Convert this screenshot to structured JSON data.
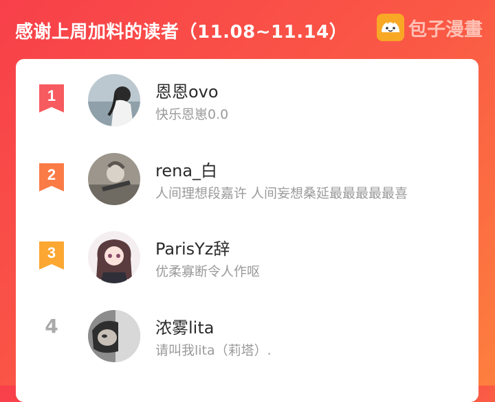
{
  "header": {
    "title": "感谢上周加料的读者（11.08~11.14）",
    "brand_name": "包子漫畫",
    "brand_logo": "bun-logo-icon"
  },
  "colors": {
    "bg_start": "#f8404a",
    "bg_end": "#fd7f3e",
    "rank1": "#f75a5f",
    "rank2": "#fb7b46",
    "rank3": "#fba732",
    "rank_plain": "#a9a9a9"
  },
  "readers": [
    {
      "rank": "1",
      "name": "恩恩ovo",
      "motto": "快乐恩崽0.0"
    },
    {
      "rank": "2",
      "name": "rena_白",
      "motto": "人间理想段嘉许 人间妄想桑延最最最最最喜"
    },
    {
      "rank": "3",
      "name": "ParisYz辞",
      "motto": "优柔寡断令人作呕"
    },
    {
      "rank": "4",
      "name": "浓雾lita",
      "motto": "请叫我lita（莉塔）."
    }
  ]
}
